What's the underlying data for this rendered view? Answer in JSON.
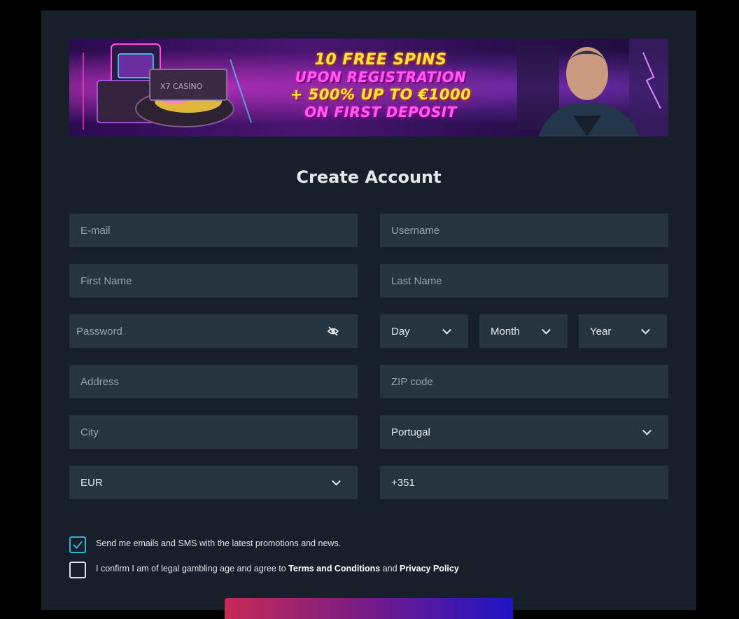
{
  "banner": {
    "line1": "10 FREE SPINS",
    "line2": "UPON REGISTRATION",
    "line3": "+ 500% UP TO €1000",
    "line4": "ON FIRST DEPOSIT",
    "logo_text": "X7 CASINO"
  },
  "form": {
    "title": "Create Account",
    "email": {
      "placeholder": "E-mail"
    },
    "username": {
      "placeholder": "Username"
    },
    "first_name": {
      "placeholder": "First Name"
    },
    "last_name": {
      "placeholder": "Last Name"
    },
    "password": {
      "placeholder": "Password",
      "icon": "eye-off-icon"
    },
    "dob": {
      "day": "Day",
      "month": "Month",
      "year": "Year"
    },
    "address": {
      "placeholder": "Address"
    },
    "zip": {
      "placeholder": "ZIP code"
    },
    "city": {
      "placeholder": "City"
    },
    "country": {
      "value": "Portugal"
    },
    "currency": {
      "value": "EUR"
    },
    "phone": {
      "value": "+351"
    }
  },
  "consents": {
    "promo": {
      "text": "Send me emails and SMS with the latest promotions and news.",
      "checked": true
    },
    "terms": {
      "prefix": "I confirm I am of legal gambling age and agree to ",
      "terms_link": "Terms and Conditions",
      "middle": " and ",
      "privacy_link": "Privacy Policy",
      "checked": false
    }
  },
  "colors": {
    "background": "#17202a",
    "field": "#25343f",
    "accent": "#2fb2d6"
  }
}
